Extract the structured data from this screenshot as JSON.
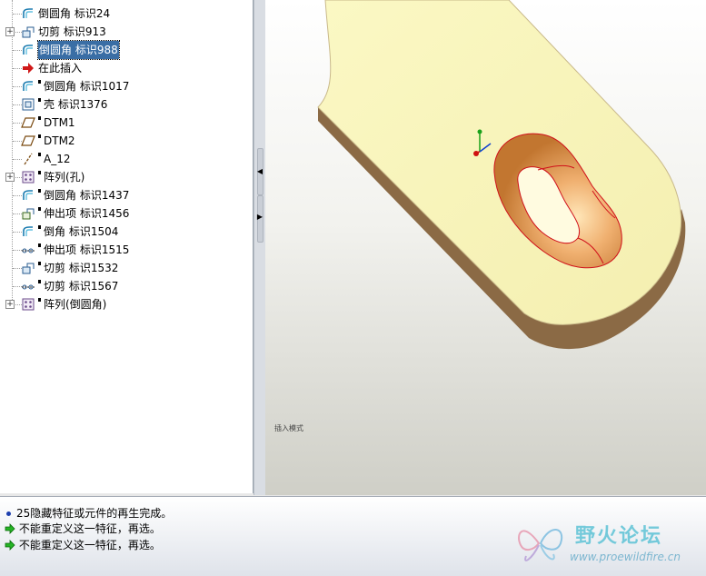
{
  "model_tree": {
    "items": [
      {
        "label": "倒圆角 标识24",
        "icon": "round-icon",
        "expandable": false,
        "dot": false,
        "selected": false
      },
      {
        "label": "切剪 标识913",
        "icon": "cut-icon",
        "expandable": true,
        "dot": false,
        "selected": false
      },
      {
        "label": "倒圆角 标识988",
        "icon": "round-icon",
        "expandable": false,
        "dot": false,
        "selected": true
      },
      {
        "label": "在此插入",
        "icon": "insert-here-arrow-icon",
        "expandable": false,
        "dot": false,
        "selected": false
      },
      {
        "label": "倒圆角 标识1017",
        "icon": "round-icon",
        "expandable": false,
        "dot": true,
        "selected": false
      },
      {
        "label": "壳 标识1376",
        "icon": "shell-icon",
        "expandable": false,
        "dot": true,
        "selected": false
      },
      {
        "label": "DTM1",
        "icon": "datum-plane-icon",
        "expandable": false,
        "dot": true,
        "selected": false
      },
      {
        "label": "DTM2",
        "icon": "datum-plane-icon",
        "expandable": false,
        "dot": true,
        "selected": false
      },
      {
        "label": "A_12",
        "icon": "datum-axis-icon",
        "expandable": false,
        "dot": true,
        "selected": false
      },
      {
        "label": "阵列(孔)",
        "icon": "pattern-icon",
        "expandable": true,
        "dot": true,
        "selected": false
      },
      {
        "label": "倒圆角 标识1437",
        "icon": "round-icon",
        "expandable": false,
        "dot": true,
        "selected": false
      },
      {
        "label": "伸出项 标识1456",
        "icon": "extrude-icon",
        "expandable": false,
        "dot": true,
        "selected": false
      },
      {
        "label": "倒角 标识1504",
        "icon": "round-icon",
        "expandable": false,
        "dot": true,
        "selected": false
      },
      {
        "label": "伸出项 标识1515",
        "icon": "revolve-icon",
        "expandable": false,
        "dot": true,
        "selected": false
      },
      {
        "label": "切剪 标识1532",
        "icon": "cut-icon",
        "expandable": false,
        "dot": true,
        "selected": false
      },
      {
        "label": "切剪 标识1567",
        "icon": "revolve-icon",
        "expandable": false,
        "dot": true,
        "selected": false
      },
      {
        "label": "阵列(倒圆角)",
        "icon": "pattern-icon",
        "expandable": true,
        "dot": true,
        "selected": false
      }
    ]
  },
  "viewport": {
    "label": "插入模式"
  },
  "messages": [
    {
      "icon": "info-bullet-icon",
      "text": "25隐藏特征或元件的再生完成。"
    },
    {
      "icon": "green-arrow-icon",
      "text": "不能重定义这一特征，再选。"
    },
    {
      "icon": "green-arrow-icon",
      "text": "不能重定义这一特征，再选。"
    }
  ],
  "watermark": {
    "title": "野火论坛",
    "url": "www.proewildfire.cn"
  },
  "colors": {
    "part_face": "#f8f5b8",
    "part_side": "#8b6a45",
    "hole_inner": "#e09a55",
    "selection": "#3a6ea5",
    "edge_highlight": "#d0101a"
  }
}
